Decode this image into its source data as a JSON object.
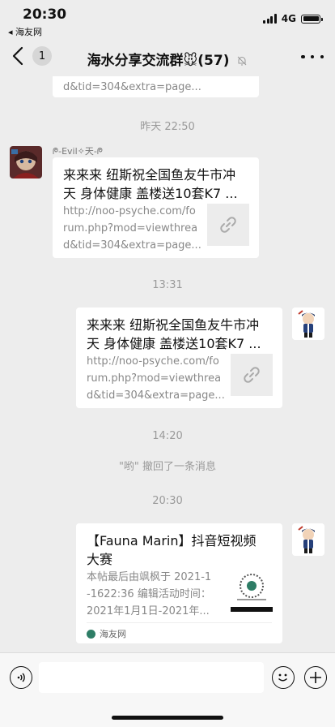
{
  "status_bar": {
    "time": "20:30",
    "back_app": "◂ 海友网",
    "network": "4G"
  },
  "header": {
    "back_badge": "1",
    "title": "海水分享交流群🐭(57)",
    "mute_icon": "bell-off-icon"
  },
  "messages": {
    "top_partial": {
      "desc_line": "d&tid=304&extra=page..."
    },
    "time1": "昨天 22:50",
    "msg1": {
      "sender": "ᖘ-Evil✧天-ᖘ",
      "title": "来来来 纽斯祝全国鱼友牛市冲\n天 身体健康 盖楼送10套K7 ...",
      "desc": "http://noo-psyche.com/fo\nrum.php?mod=viewthrea\nd&tid=304&extra=page..."
    },
    "time2": "13:31",
    "msg2": {
      "title": "来来来 纽斯祝全国鱼友牛市冲\n天 身体健康 盖楼送10套K7 ...",
      "desc": "http://noo-psyche.com/fo\nrum.php?mod=viewthrea\nd&tid=304&extra=page..."
    },
    "time3": "14:20",
    "recall": "\"哟\" 撤回了一条消息",
    "time4": "20:30",
    "msg3": {
      "title": "【Fauna Marin】抖音短视频\n大赛",
      "desc": "本帖最后由飒枫于 2021-1\n-1622:36 编辑活动时间：\n2021年1月1日-2021年...",
      "source": "海友网"
    }
  },
  "colors": {
    "background": "#ededed",
    "bubble": "#ffffff",
    "meta_text": "#9a9a9a"
  }
}
